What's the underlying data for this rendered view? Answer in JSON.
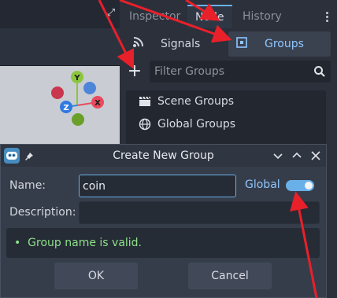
{
  "dock": {
    "tabs": [
      {
        "label": "Inspector",
        "active": false
      },
      {
        "label": "Node",
        "active": true
      },
      {
        "label": "History",
        "active": false
      }
    ],
    "subtabs": {
      "signals_label": "Signals",
      "groups_label": "Groups"
    },
    "filter": {
      "placeholder": "Filter Groups"
    },
    "groups": [
      {
        "label": "Scene Groups",
        "icon": "clapperboard-icon"
      },
      {
        "label": "Global Groups",
        "icon": "globe-icon"
      }
    ]
  },
  "viewport": {
    "gizmo_axes": [
      "Y",
      "Z",
      "X"
    ]
  },
  "dialog": {
    "title": "Create New Group",
    "name_label": "Name:",
    "name_value": "coin",
    "global_label": "Global",
    "global_enabled": true,
    "description_label": "Description:",
    "description_value": "",
    "validation_bullet": "•",
    "validation_text": "Group name is valid.",
    "ok_label": "OK",
    "cancel_label": "Cancel"
  },
  "colors": {
    "accent": "#6ab0e8",
    "valid": "#8ee08a",
    "annotation_arrow": "#e8202a"
  }
}
